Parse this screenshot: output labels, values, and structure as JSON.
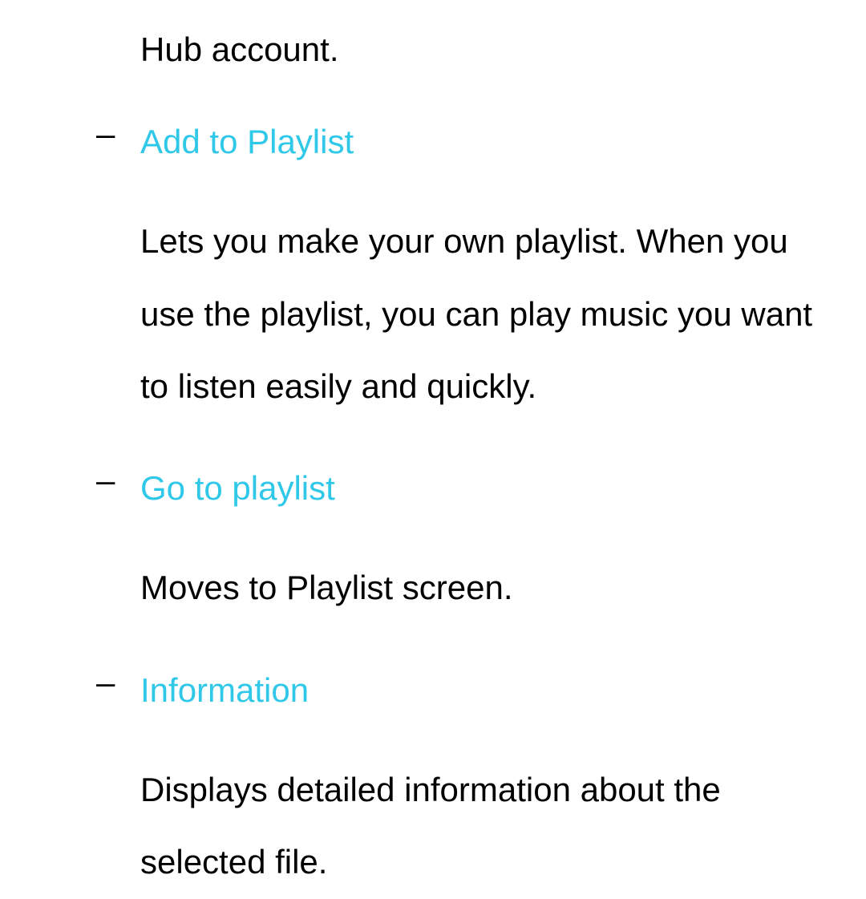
{
  "fragment_text": "Hub account.",
  "items": [
    {
      "title": "Add to Playlist",
      "description": "Lets you make your own playlist. When you use the playlist, you can play music you want to listen easily and quickly."
    },
    {
      "title": "Go to playlist",
      "description": "Moves to Playlist screen."
    },
    {
      "title": "Information",
      "description": "Displays detailed information about the selected file."
    }
  ],
  "dash": "–"
}
